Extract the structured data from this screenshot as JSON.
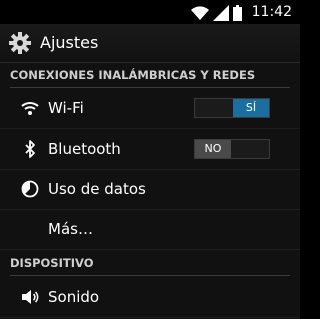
{
  "status_bar": {
    "time": "11:42",
    "icons": [
      "wifi-icon",
      "signal-icon",
      "battery-icon"
    ]
  },
  "action_bar": {
    "title": "Ajustes",
    "icon": "settings-gear-icon"
  },
  "sections": {
    "wireless": "CONEXIONES INALÁMBRICAS Y REDES",
    "device": "DISPOSITIVO"
  },
  "items": [
    {
      "label": "Wi-Fi",
      "icon": "wifi-icon",
      "toggle": "SÍ",
      "toggle_on": true
    },
    {
      "label": "Bluetooth",
      "icon": "bluetooth-icon",
      "toggle": "NO",
      "toggle_on": false
    },
    {
      "label": "Uso de datos",
      "icon": "data-usage-icon"
    },
    {
      "label": "Más…"
    },
    {
      "label": "Sonido",
      "icon": "sound-icon"
    }
  ],
  "colors": {
    "accent": "#1a6fa0",
    "background": "#111111"
  }
}
